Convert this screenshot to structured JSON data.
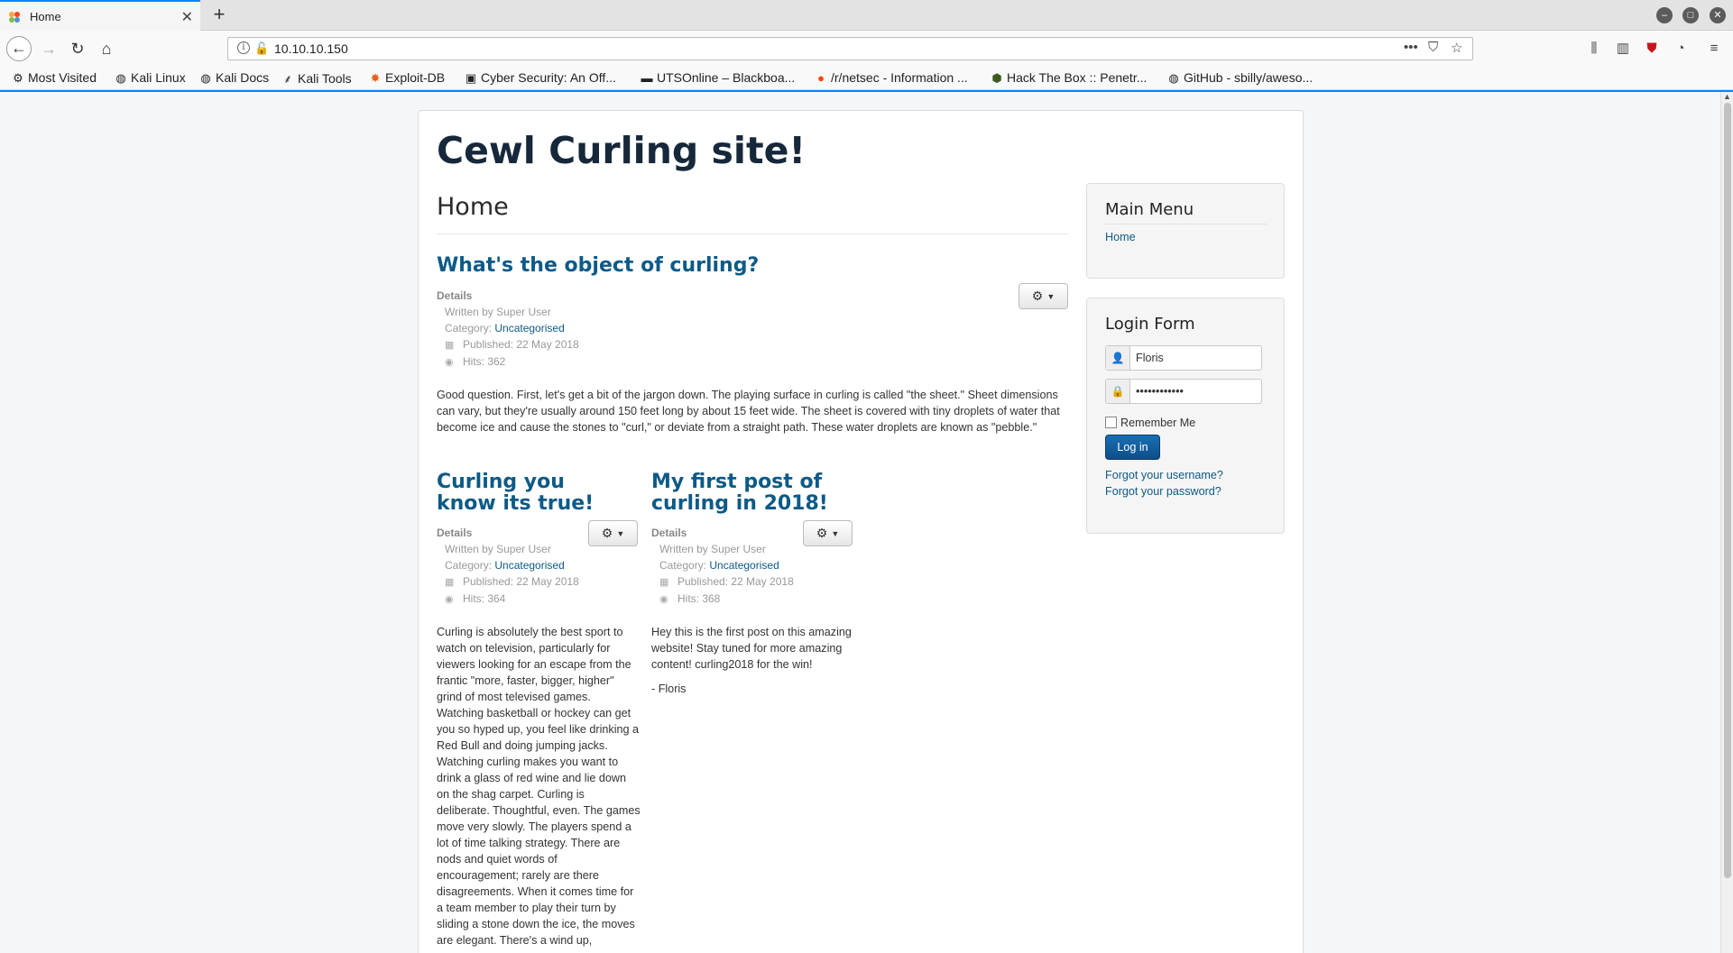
{
  "browser": {
    "tab_title": "Home",
    "new_tab_symbol": "+",
    "url": "10.10.10.150",
    "bookmarks": [
      {
        "label": "Most Visited",
        "icon": "gear-icon"
      },
      {
        "label": "Kali Linux",
        "icon": "globe-icon"
      },
      {
        "label": "Kali Docs",
        "icon": "globe-icon"
      },
      {
        "label": "Kali Tools",
        "icon": "kali-icon"
      },
      {
        "label": "Exploit-DB",
        "icon": "exploitdb-icon"
      },
      {
        "label": "Cyber Security: An Off...",
        "icon": "shield-icon"
      },
      {
        "label": "UTSOnline – Blackboa...",
        "icon": "uts-icon"
      },
      {
        "label": "/r/netsec - Information ...",
        "icon": "reddit-icon"
      },
      {
        "label": "Hack The Box :: Penetr...",
        "icon": "htb-icon"
      },
      {
        "label": "GitHub - sbilly/aweso...",
        "icon": "globe-icon"
      }
    ]
  },
  "site": {
    "title": "Cewl Curling site!",
    "page_title": "Home"
  },
  "articles": [
    {
      "title": "What's the object of curling?",
      "details_label": "Details",
      "author": "Written by Super User",
      "category_label": "Category: ",
      "category": "Uncategorised",
      "published": "Published: 22 May 2018",
      "hits": "Hits: 362",
      "paragraphs": [
        "Good question. First, let's get a bit of the jargon down. The playing surface in curling is called \"the sheet.\" Sheet dimensions can vary, but they're usually around 150 feet long by about 15 feet wide. The sheet is covered with tiny droplets of water that become ice and cause the stones to \"curl,\" or deviate from a straight path. These water droplets are known as \"pebble.\""
      ]
    },
    {
      "title": "Curling you know its true!",
      "details_label": "Details",
      "author": "Written by Super User",
      "category_label": "Category: ",
      "category": "Uncategorised",
      "published": "Published: 22 May 2018",
      "hits": "Hits: 364",
      "paragraphs": [
        "Curling is absolutely the best sport to watch on television, particularly for viewers looking for an escape from the frantic \"more, faster, bigger, higher\" grind of most televised games. Watching basketball or hockey can get you so hyped up, you feel like drinking a Red Bull and doing jumping jacks. Watching curling makes you want to drink a glass of red wine and lie down on the shag carpet. Curling is deliberate. Thoughtful, even. The games move very slowly. The players spend a lot of time talking strategy. There are nods and quiet words of encouragement; rarely are there disagreements. When it comes time for a team member to play their turn by sliding a stone down the ice, the moves are elegant. There's a wind up,"
      ]
    },
    {
      "title": "My first post of curling in 2018!",
      "details_label": "Details",
      "author": "Written by Super User",
      "category_label": "Category: ",
      "category": "Uncategorised",
      "published": "Published: 22 May 2018",
      "hits": "Hits: 368",
      "paragraphs": [
        "Hey this is the first post on this amazing website! Stay tuned for more amazing content! curling2018 for the win!",
        "- Floris"
      ]
    }
  ],
  "sidebar": {
    "main_menu": {
      "title": "Main Menu",
      "items": [
        "Home"
      ]
    },
    "login_form": {
      "title": "Login Form",
      "username_value": "Floris",
      "password_value": "••••••••••••",
      "remember_label": "Remember Me",
      "login_button": "Log in",
      "forgot_username": "Forgot your username?",
      "forgot_password": "Forgot your password?"
    }
  },
  "colors": {
    "link": "#0d5a87",
    "heading": "#16283a",
    "tab_accent": "#0a84ff",
    "login_button": "#0d4e8a"
  }
}
